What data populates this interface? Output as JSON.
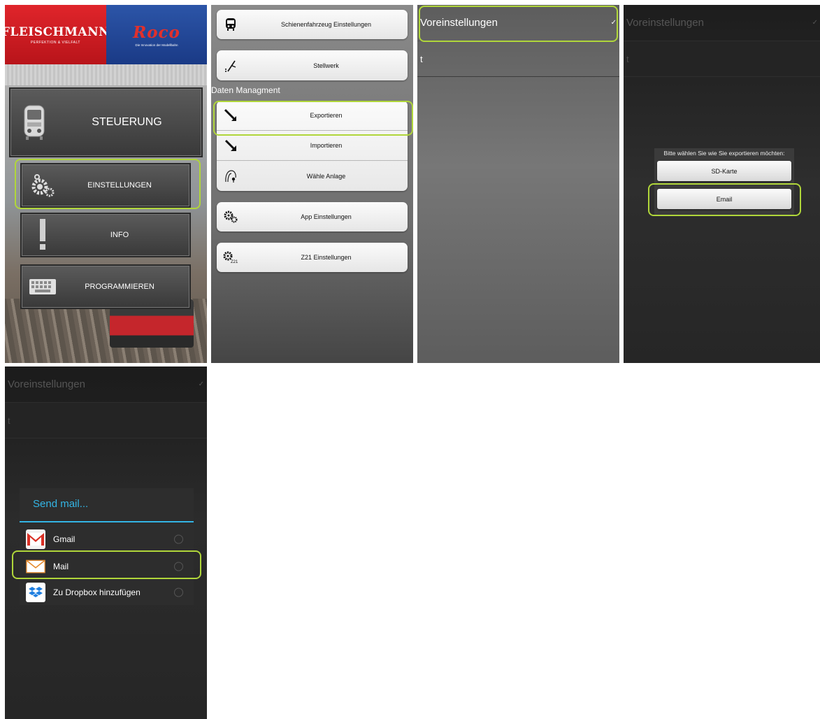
{
  "main_menu": {
    "logo_fleischmann": "FLEISCHMANN",
    "logo_fleischmann_tagline": "PERFEKTION & VIELFALT",
    "logo_roco": "Roco",
    "logo_roco_tagline": "Die Innovation der Modellbahn",
    "buttons": [
      {
        "label": "STEUERUNG",
        "icon": "train-icon"
      },
      {
        "label": "EINSTELLUNGEN",
        "icon": "gears-icon"
      },
      {
        "label": "INFO",
        "icon": "exclamation-icon"
      },
      {
        "label": "PROGRAMMIEREN",
        "icon": "keyboard-icon"
      }
    ]
  },
  "settings": {
    "items_top": [
      {
        "label": "Schienenfahrzeug Einstellungen",
        "icon": "train-icon"
      },
      {
        "label": "Stellwerk",
        "icon": "switch-lever-icon"
      }
    ],
    "section_label": "Daten Managment",
    "data_group": [
      {
        "label": "Exportieren",
        "icon": "arrow-export-icon"
      },
      {
        "label": "Importieren",
        "icon": "arrow-import-icon"
      },
      {
        "label": "Wähle Anlage",
        "icon": "layout-icon"
      }
    ],
    "items_bottom": [
      {
        "label": "App Einstellungen",
        "icon": "gears-icon"
      },
      {
        "label": "Z21 Einstellungen",
        "icon": "z21-gear-icon"
      }
    ]
  },
  "preferences": {
    "header": "Voreinstellungen",
    "check": "✓",
    "item": "t"
  },
  "export_dialog": {
    "title": "Bitte wählen Sie wie Sie exportieren möchten:",
    "options": [
      "SD-Karte",
      "Email"
    ]
  },
  "send_dialog": {
    "title": "Send mail...",
    "apps": [
      {
        "label": "Gmail",
        "icon": "gmail-icon"
      },
      {
        "label": "Mail",
        "icon": "mail-envelope-icon"
      },
      {
        "label": "Zu Dropbox hinzufügen",
        "icon": "dropbox-icon"
      }
    ]
  },
  "colors": {
    "highlight": "#b0d63a",
    "holo_blue": "#33b5e5",
    "fleischmann_red": "#d01f25",
    "roco_blue": "#22479a"
  }
}
